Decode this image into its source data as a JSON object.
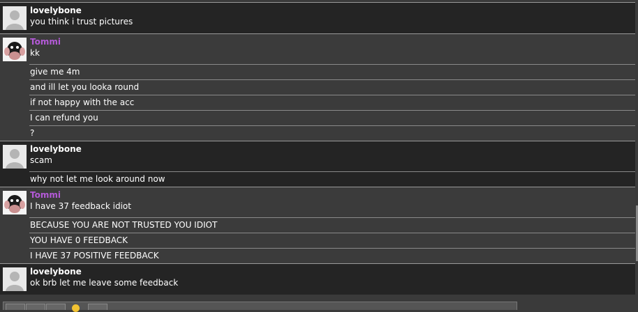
{
  "messages": [
    {
      "user": "lovelybone",
      "color": "#ffffff",
      "avatar": "default-avatar",
      "lines": [
        "you think i trust pictures"
      ]
    },
    {
      "user": "Tommi",
      "color": "#b45ad8",
      "avatar": "tommi-avatar",
      "lines": [
        "kk",
        "give me 4m",
        "and ill let you looka round",
        "if not happy with the acc",
        "I can refund you",
        "?"
      ]
    },
    {
      "user": "lovelybone",
      "color": "#ffffff",
      "avatar": "default-avatar",
      "lines": [
        "scam",
        "why not let me look around now"
      ]
    },
    {
      "user": "Tommi",
      "color": "#b45ad8",
      "avatar": "tommi-avatar",
      "lines": [
        "I have 37 feedback idiot",
        "BECAUSE YOU ARE NOT TRUSTED YOU IDIOT",
        "YOU HAVE 0 FEEDBACK",
        "I HAVE 37 POSITIVE FEEDBACK"
      ]
    },
    {
      "user": "lovelybone",
      "color": "#ffffff",
      "avatar": "default-avatar",
      "lines": [
        "ok brb let me leave some feedback"
      ]
    }
  ],
  "toolbar": {
    "buttons": [
      "bold-icon",
      "italic-icon",
      "underline-icon",
      "smiley-icon",
      "more-icon"
    ]
  }
}
